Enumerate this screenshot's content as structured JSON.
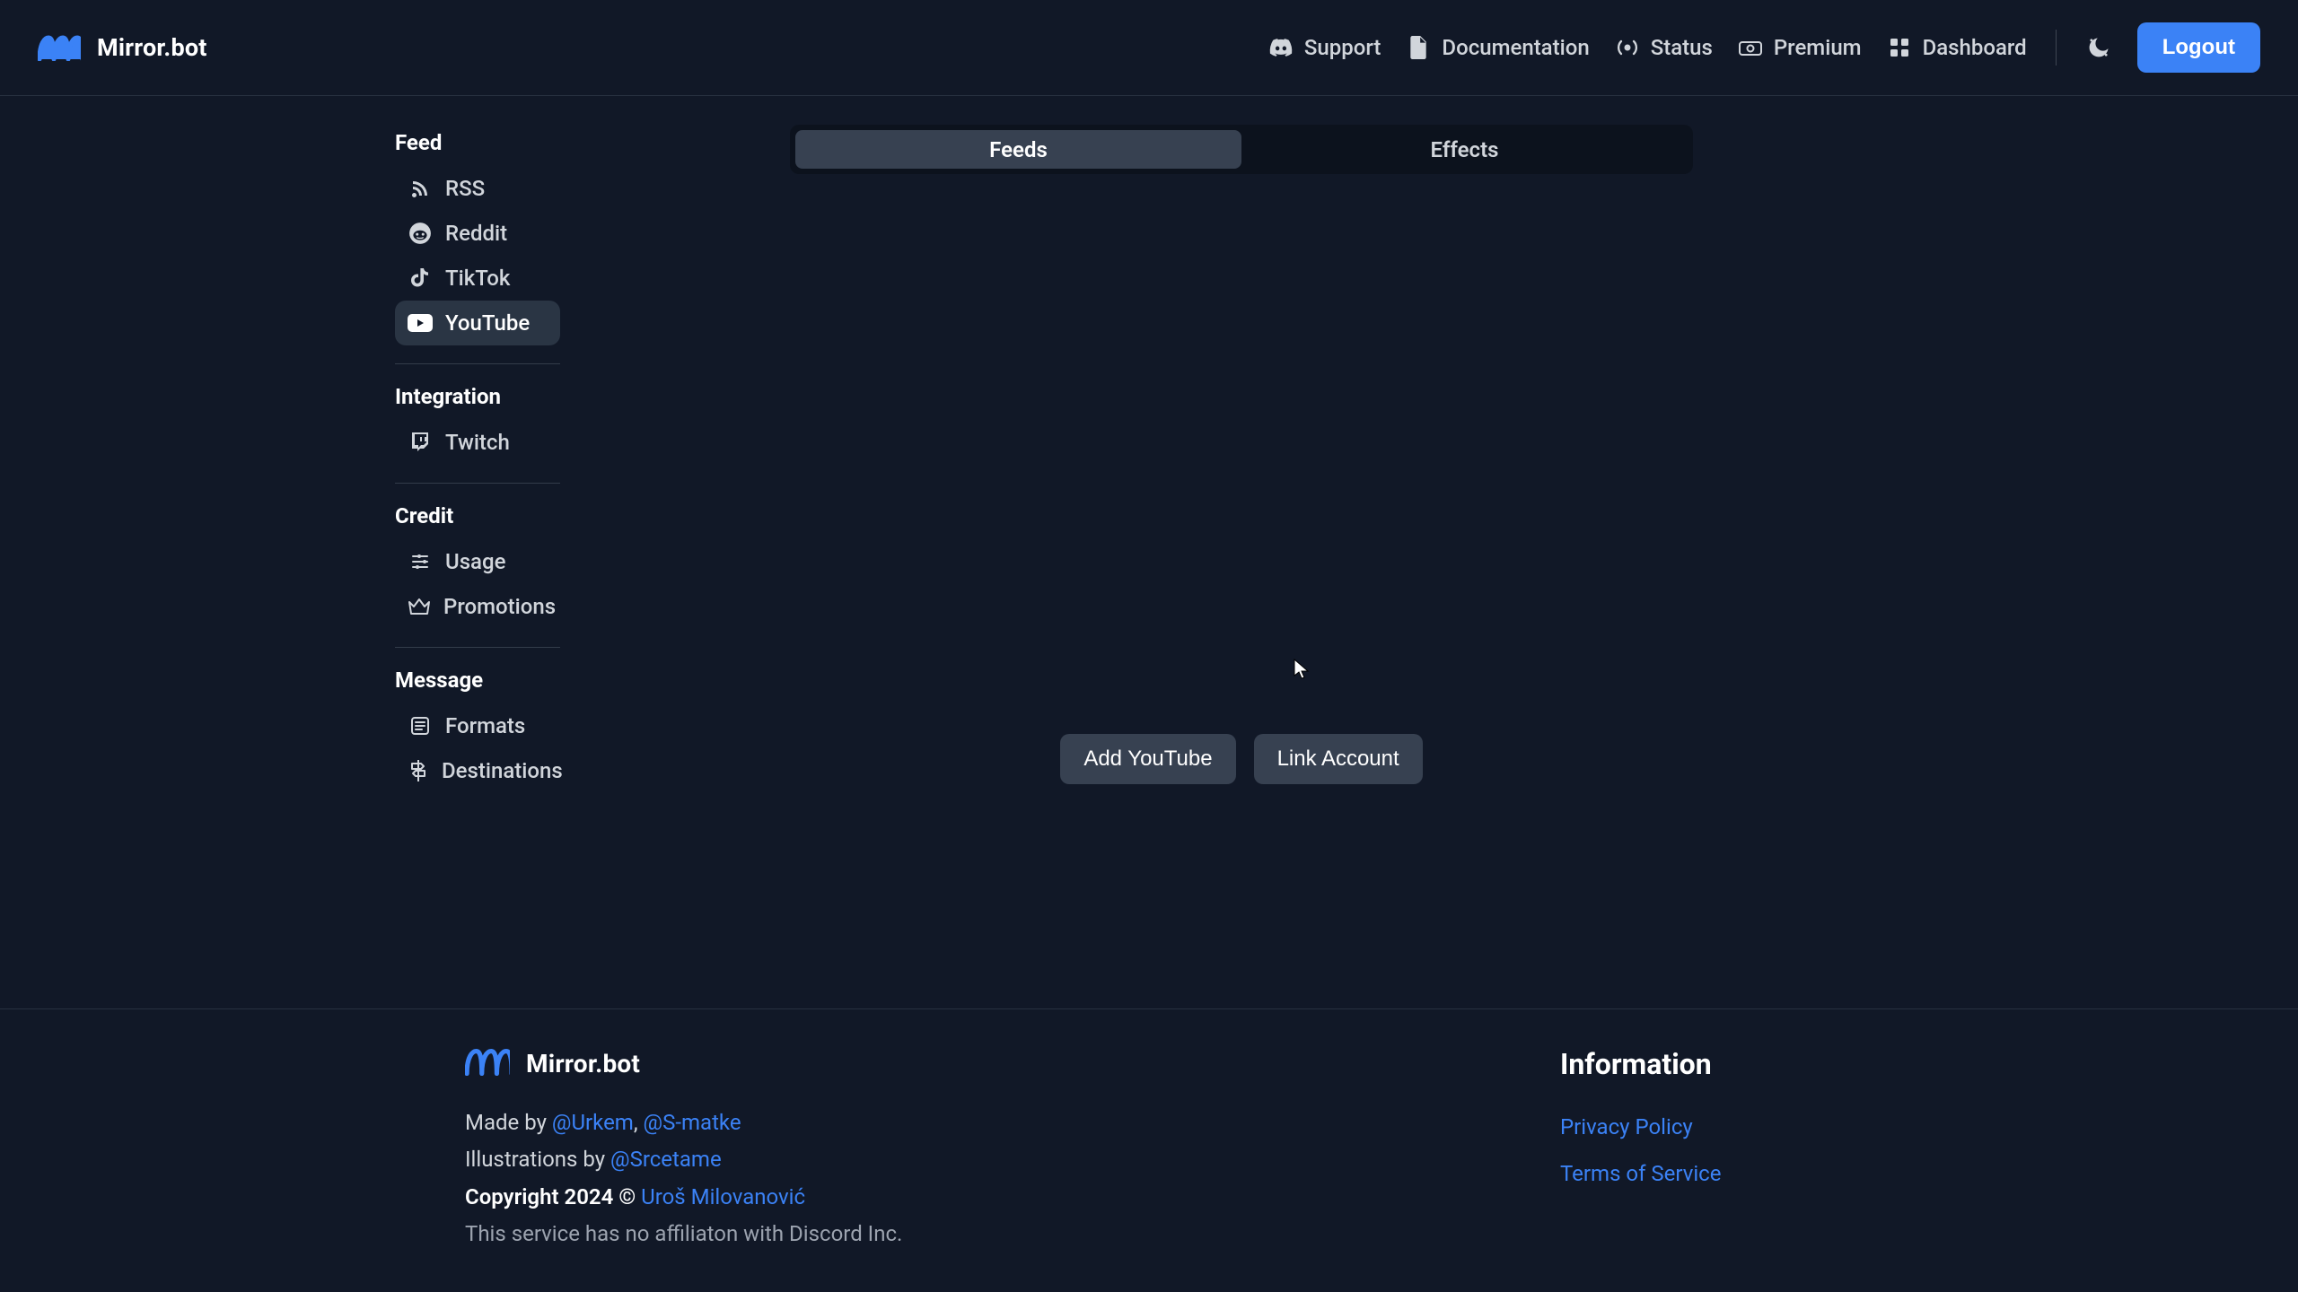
{
  "brand": {
    "name": "Mirror.bot"
  },
  "topnav": {
    "support": "Support",
    "documentation": "Documentation",
    "status": "Status",
    "premium": "Premium",
    "dashboard": "Dashboard",
    "logout": "Logout"
  },
  "sidebar": {
    "feed": {
      "title": "Feed",
      "items": [
        "RSS",
        "Reddit",
        "TikTok",
        "YouTube"
      ],
      "active_index": 3
    },
    "integration": {
      "title": "Integration",
      "items": [
        "Twitch"
      ]
    },
    "credit": {
      "title": "Credit",
      "items": [
        "Usage",
        "Promotions"
      ]
    },
    "message": {
      "title": "Message",
      "items": [
        "Formats",
        "Destinations"
      ]
    }
  },
  "tabs": {
    "feeds": "Feeds",
    "effects": "Effects",
    "active": "feeds"
  },
  "actions": {
    "add_youtube": "Add YouTube",
    "link_account": "Link Account"
  },
  "footer": {
    "made_by_prefix": "Made by ",
    "made_by_1": "@Urkem",
    "made_by_sep": ", ",
    "made_by_2": "@S-matke",
    "illustrations_prefix": "Illustrations by ",
    "illustrations_by": "@Srcetame",
    "copyright_prefix": "Copyright 2024 © ",
    "copyright_name": "Uroš Milovanović",
    "disclaimer": "This service has no affiliaton with Discord Inc.",
    "info_heading": "Information",
    "privacy": "Privacy Policy",
    "tos": "Terms of Service"
  }
}
